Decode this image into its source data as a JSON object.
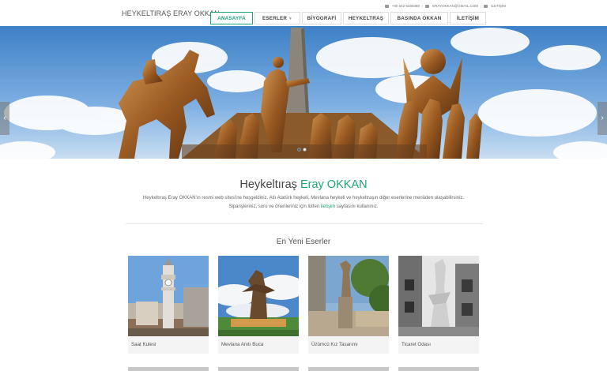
{
  "header": {
    "brand": "HEYKELTIRAŞ ERAY OKKAN",
    "phone": "+90 542 5230388",
    "email": "ERAYOKKAN@GMAIL.COM",
    "contact_link": "İLETİŞİM"
  },
  "nav": {
    "items": [
      {
        "label": "ANASAYFA"
      },
      {
        "label": "ESERLER"
      },
      {
        "label": "BİYOGRAFİ"
      },
      {
        "label": "HEYKELTRAŞ"
      },
      {
        "label": "BASINDA OKKAN"
      },
      {
        "label": "İLETİŞİM"
      }
    ]
  },
  "hero": {
    "prev_arrow": "‹",
    "next_arrow": "›",
    "active_slide": 1,
    "slide_count": 2
  },
  "intro": {
    "title_plain": "Heykeltıraş ",
    "title_highlight": "Eray OKKAN",
    "line1": "Heykeltıraş Eray OKKAN'ın resmi web sitesi'ne hoşgeldiniz. Atlı Atatürk heykeli, Mevlana heykeli ve heykeltraşın diğer eserlerine menüden ulaşabilirsiniz.",
    "line2_before": "Siparişleriniz, soru ve önerileriniz için lütfen ",
    "line2_link": "iletişim",
    "line2_after": " sayfasını kullanınız."
  },
  "works": {
    "title": "En Yeni Eserler",
    "items": [
      {
        "label": "Saat Kulesi"
      },
      {
        "label": "Mevlana Anıtı Buca"
      },
      {
        "label": "Üzümcü Kız Tasarımı"
      },
      {
        "label": "Ticaret Odası"
      }
    ]
  },
  "colors": {
    "accent": "#1aa47c"
  }
}
